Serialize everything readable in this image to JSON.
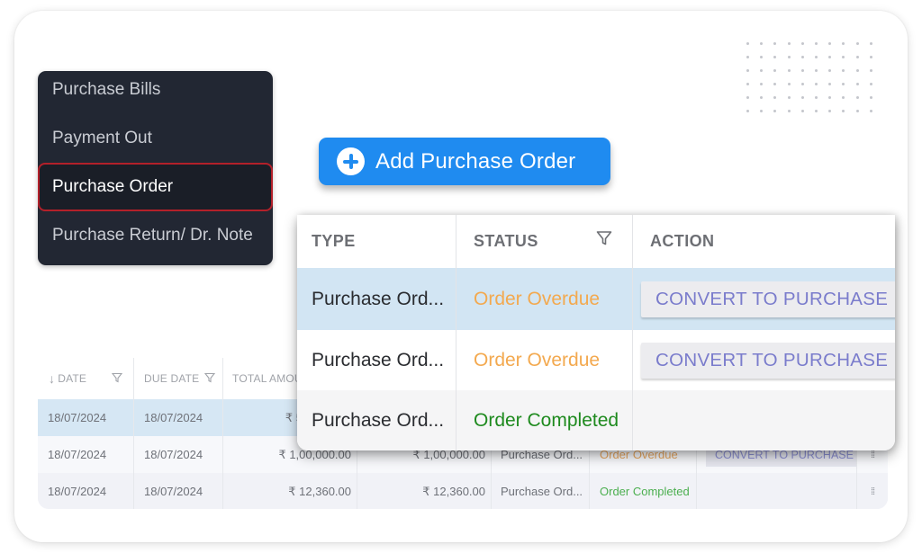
{
  "side_menu": {
    "items": [
      {
        "label": "Purchase Bills",
        "active": false
      },
      {
        "label": "Payment Out",
        "active": false
      },
      {
        "label": "Purchase Order",
        "active": true
      },
      {
        "label": "Purchase Return/ Dr. Note",
        "active": false
      }
    ]
  },
  "add_button": {
    "label": "Add Purchase Order",
    "icon": "plus-circle-icon",
    "color": "#1f8bf0"
  },
  "overlay_table": {
    "headers": {
      "type": "TYPE",
      "status": "STATUS",
      "action": "ACTION"
    },
    "rows": [
      {
        "type": "Purchase Ord...",
        "status": "Order Overdue",
        "status_kind": "overdue",
        "action": "CONVERT TO PURCHASE"
      },
      {
        "type": "Purchase Ord...",
        "status": "Order Overdue",
        "status_kind": "overdue",
        "action": "CONVERT TO PURCHASE"
      },
      {
        "type": "Purchase Ord...",
        "status": "Order Completed",
        "status_kind": "completed",
        "action": ""
      }
    ]
  },
  "background_table": {
    "headers": {
      "date": "DATE",
      "due_date": "DUE DATE",
      "total_amount": "TOTAL AMOU"
    },
    "rows": [
      {
        "date": "18/07/2024",
        "due_date": "18/07/2024",
        "total": "₹ 5",
        "balance": "",
        "type": "",
        "status": "",
        "action": ""
      },
      {
        "date": "18/07/2024",
        "due_date": "18/07/2024",
        "total": "₹ 1,00,000.00",
        "balance": "₹ 1,00,000.00",
        "type": "Purchase Ord...",
        "status": "Order Overdue",
        "action": "CONVERT TO PURCHASE"
      },
      {
        "date": "18/07/2024",
        "due_date": "18/07/2024",
        "total": "₹ 12,360.00",
        "balance": "₹ 12,360.00",
        "type": "Purchase Ord...",
        "status": "Order Completed",
        "action": ""
      }
    ]
  },
  "colors": {
    "overdue": "#f3a94f",
    "completed": "#1e8a1e",
    "highlight_row": "#d2e5f3",
    "active_outline": "#b3202a",
    "menu_bg": "#222733"
  }
}
